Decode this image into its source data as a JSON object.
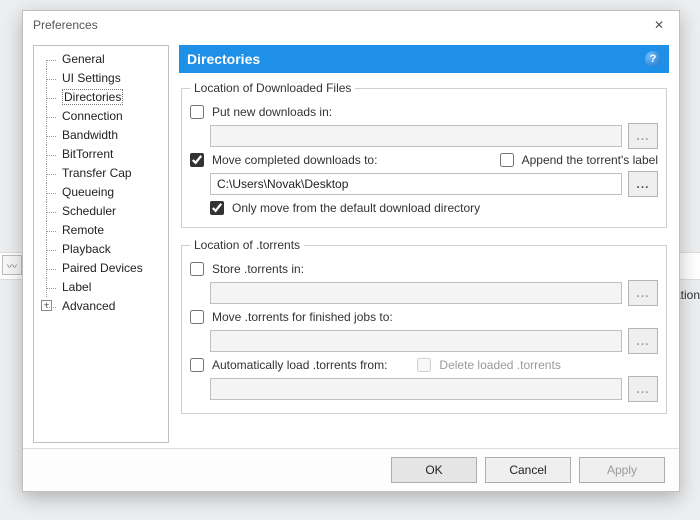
{
  "window": {
    "title": "Preferences",
    "close_glyph": "✕"
  },
  "tree": {
    "items": [
      {
        "label": "General"
      },
      {
        "label": "UI Settings"
      },
      {
        "label": "Directories",
        "selected": true
      },
      {
        "label": "Connection"
      },
      {
        "label": "Bandwidth"
      },
      {
        "label": "BitTorrent"
      },
      {
        "label": "Transfer Cap"
      },
      {
        "label": "Queueing"
      },
      {
        "label": "Scheduler"
      },
      {
        "label": "Remote"
      },
      {
        "label": "Playback"
      },
      {
        "label": "Paired Devices"
      },
      {
        "label": "Label"
      },
      {
        "label": "Advanced",
        "expandable": true,
        "expander_glyph": "+"
      }
    ]
  },
  "panel": {
    "title": "Directories",
    "help_glyph": "?",
    "groups": {
      "downloaded": {
        "legend": "Location of Downloaded Files",
        "put_new": {
          "checked": false,
          "label": "Put new downloads in:",
          "path": ""
        },
        "move_completed": {
          "checked": true,
          "label": "Move completed downloads to:",
          "path": "C:\\Users\\Novak\\Desktop"
        },
        "append_label": {
          "checked": false,
          "label": "Append the torrent's label"
        },
        "only_move_default": {
          "checked": true,
          "label": "Only move from the default download directory"
        }
      },
      "torrents": {
        "legend": "Location of .torrents",
        "store": {
          "checked": false,
          "label": "Store .torrents in:",
          "path": ""
        },
        "move_finished": {
          "checked": false,
          "label": "Move .torrents for finished jobs to:",
          "path": ""
        },
        "auto_load": {
          "checked": false,
          "label": "Automatically load .torrents from:",
          "path": ""
        },
        "delete_loaded": {
          "checked": false,
          "label": "Delete loaded .torrents"
        }
      }
    },
    "browse_glyph": "..."
  },
  "footer": {
    "ok": "OK",
    "cancel": "Cancel",
    "apply": "Apply"
  },
  "background": {
    "right_fragment": "ation",
    "left_btn_glyph": "〰"
  }
}
